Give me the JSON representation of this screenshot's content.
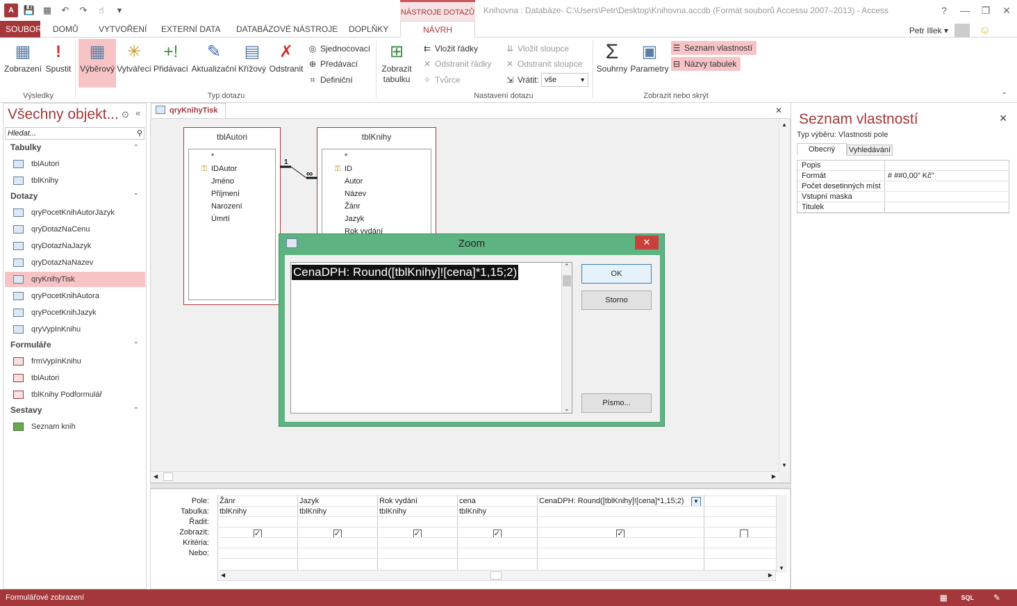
{
  "titlebar": {
    "app_icon": "A",
    "context_label": "NÁSTROJE DOTAZŮ",
    "title": "Knihovna : Databáze- C:\\Users\\Petr\\Desktop\\Knihovna.accdb (Formát souborů Accessu 2007–2013) - Access",
    "help": "?",
    "minimize": "—",
    "restore": "❐",
    "close": "✕"
  },
  "tabs": {
    "file": "SOUBOR",
    "home": "DOMŮ",
    "create": "VYTVOŘENÍ",
    "external": "EXTERNÍ DATA",
    "dbtools": "DATABÁZOVÉ NÁSTROJE",
    "addins": "DOPLŇKY",
    "design": "NÁVRH"
  },
  "user": {
    "name": "Petr Illek"
  },
  "ribbon": {
    "results": {
      "label": "Výsledky",
      "view": "Zobrazení",
      "run": "Spustit"
    },
    "query_type": {
      "label": "Typ dotazu",
      "select": "Výběrový",
      "make": "Vytvářecí",
      "append": "Přidávací",
      "update": "Aktualizační",
      "crosstab": "Křížový",
      "delete": "Odstranit",
      "union": "Sjednocovací",
      "passthrough": "Předávací",
      "definition": "Definiční"
    },
    "show_table": "Zobrazit tabulku",
    "setup": {
      "label": "Nastavení dotazu",
      "insert_rows": "Vložit řádky",
      "delete_rows": "Odstranit řádky",
      "builder": "Tvůrce",
      "insert_cols": "Vložit sloupce",
      "delete_cols": "Odstranit sloupce",
      "return_label": "Vrátit:",
      "return_value": "vše"
    },
    "show_hide": {
      "label": "Zobrazit nebo skrýt",
      "totals": "Souhrny",
      "params": "Parametry",
      "prop_sheet": "Seznam vlastností",
      "table_names": "Názvy tabulek"
    }
  },
  "nav": {
    "title": "Všechny objekt...",
    "search_placeholder": "Hledat...",
    "groups": [
      {
        "name": "Tabulky",
        "items": [
          "tblAutori",
          "tblKnihy"
        ]
      },
      {
        "name": "Dotazy",
        "items": [
          "qryPocetKnihAutorJazyk",
          "qryDotazNaCenu",
          "qryDotazNaJazyk",
          "qryDotazNaNazev",
          "qryKnihyTisk",
          "qryPocetKnihAutora",
          "qryPocetKnihJazyk",
          "qryVypInKnihu"
        ]
      },
      {
        "name": "Formuláře",
        "items": [
          "frmVypInKnihu",
          "tblAutori",
          "tblKnihy Podformulář"
        ]
      },
      {
        "name": "Sestavy",
        "items": [
          "Seznam knih"
        ]
      }
    ]
  },
  "doc_tab": "qryKnihyTisk",
  "tables": [
    {
      "name": "tblAutori",
      "fields": [
        "*",
        "IDAutor",
        "Jméno",
        "Příjmení",
        "Narození",
        "Úmrtí"
      ]
    },
    {
      "name": "tblKnihy",
      "fields": [
        "*",
        "ID",
        "Autor",
        "Název",
        "Žánr",
        "Jazyk",
        "Rok vydání"
      ]
    }
  ],
  "relation": {
    "one": "1",
    "many": "∞"
  },
  "grid": {
    "row_labels": [
      "Pole:",
      "Tabulka:",
      "Řadit:",
      "Zobrazit:",
      "Kritéria:",
      "Nebo:"
    ],
    "columns": [
      {
        "field": "Žánr",
        "table": "tblKnihy",
        "show": true
      },
      {
        "field": "Jazyk",
        "table": "tblKnihy",
        "show": true
      },
      {
        "field": "Rok vydání",
        "table": "tblKnihy",
        "show": true
      },
      {
        "field": "cena",
        "table": "tblKnihy",
        "show": true
      },
      {
        "field": "CenaDPH: Round([tblKnihy]![cena]*1,15;2)",
        "table": "",
        "show": true
      },
      {
        "field": "",
        "table": "",
        "show": false
      }
    ]
  },
  "props": {
    "title": "Seznam vlastností",
    "selection_type": "Typ výběru:  Vlastnosti pole",
    "tab_general": "Obecný",
    "tab_lookup": "Vyhledávání",
    "rows": [
      {
        "k": "Popis",
        "v": ""
      },
      {
        "k": "Formát",
        "v": "# ##0,00\" Kč\""
      },
      {
        "k": "Počet desetinných míst",
        "v": ""
      },
      {
        "k": "Vstupní maska",
        "v": ""
      },
      {
        "k": "Titulek",
        "v": ""
      }
    ]
  },
  "zoom": {
    "title": "Zoom",
    "expression": "CenaDPH: Round([tblKnihy]![cena]*1,15;2)",
    "ok": "OK",
    "cancel": "Storno",
    "font": "Písmo..."
  },
  "status": {
    "text": "Formulářové zobrazení"
  },
  "colors": {
    "accent": "#a4373a",
    "selection": "#f7c4c6",
    "dialog_frame": "#5eb382"
  }
}
